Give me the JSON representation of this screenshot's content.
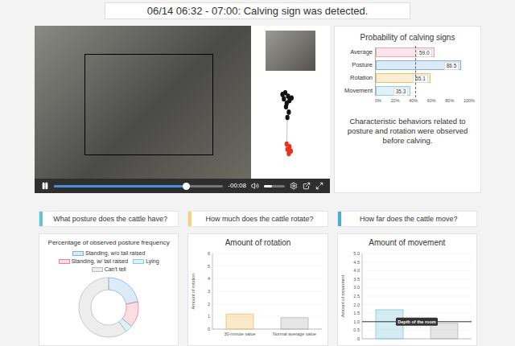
{
  "header": {
    "title": "06/14 06:32 - 07:00: Calving sign was detected."
  },
  "player": {
    "playing": true,
    "progress": 0.78,
    "remaining": "-00:08",
    "volume": 0.4,
    "trajectory": {
      "past": [
        [
          38,
          14
        ],
        [
          42,
          12
        ],
        [
          46,
          16
        ],
        [
          40,
          19
        ],
        [
          48,
          21
        ],
        [
          44,
          24
        ],
        [
          51,
          18
        ],
        [
          43,
          28
        ],
        [
          47,
          34
        ],
        [
          45,
          40
        ]
      ],
      "recent": [
        [
          44,
          70
        ],
        [
          48,
          73
        ],
        [
          45,
          76
        ],
        [
          50,
          78
        ],
        [
          47,
          81
        ]
      ]
    }
  },
  "probability": {
    "title": "Probability of calving signs",
    "threshold": 40,
    "ticks": [
      "0%",
      "20%",
      "40%",
      "60%",
      "80%",
      "100%"
    ],
    "bars": [
      {
        "label": "Average",
        "value": 59.0,
        "reading": "59.0",
        "color": "#f4a3b4"
      },
      {
        "label": "Posture",
        "value": 86.5,
        "reading": "86.5",
        "color": "#7fb0e0"
      },
      {
        "label": "Rotation",
        "value": 55.1,
        "reading": "55.1",
        "color": "#f0c060"
      },
      {
        "label": "Movement",
        "value": 35.3,
        "reading": "35.3",
        "color": "#8fd0dc"
      }
    ],
    "summary": "Characteristic behaviors related to posture and rotation were observed before calving."
  },
  "sections": [
    {
      "question": "What posture does the cattle have?",
      "color": "#66c2dc"
    },
    {
      "question": "How much does the cattle rotate?",
      "color": "#f3d27a"
    },
    {
      "question": "How far does the cattle move?",
      "color": "#4aaed0"
    }
  ],
  "posture": {
    "title": "Percentage of observed posture frequency",
    "segments": [
      {
        "label": "Standing, w/o tail raised",
        "value": 22,
        "color": "#7fb0e0"
      },
      {
        "label": "Standing, w/ tail raised",
        "value": 14,
        "color": "#f08098"
      },
      {
        "label": "Lying",
        "value": 4,
        "color": "#7fd0dc"
      },
      {
        "label": "Can't tell",
        "value": 60,
        "color": "#bbbbbb"
      }
    ]
  },
  "rotation": {
    "title": "Amount of rotation",
    "y_label": "Amount of rotation",
    "max": 6,
    "ticks": [
      "0",
      "1",
      "2",
      "3",
      "4",
      "5",
      "6"
    ],
    "bars": [
      {
        "label": "30-minute value",
        "value": 1.2,
        "color": "#f0c060"
      },
      {
        "label": "Normal average value",
        "value": 0.9,
        "color": "#b5b5b5"
      }
    ]
  },
  "movement": {
    "title": "Amount of movement",
    "y_label": "Amount of movement",
    "max": 5,
    "ticks": [
      "0",
      "0.5",
      "1.0",
      "1.5",
      "2.0",
      "2.5",
      "3.0",
      "3.5",
      "4.0",
      "4.5",
      "5.0"
    ],
    "bars": [
      {
        "value": 1.7,
        "color": "#7fc8d8"
      },
      {
        "value": 0.9,
        "color": "#b5b5b5"
      }
    ],
    "line": {
      "value": 1.0,
      "label": "Depth of the room"
    }
  }
}
